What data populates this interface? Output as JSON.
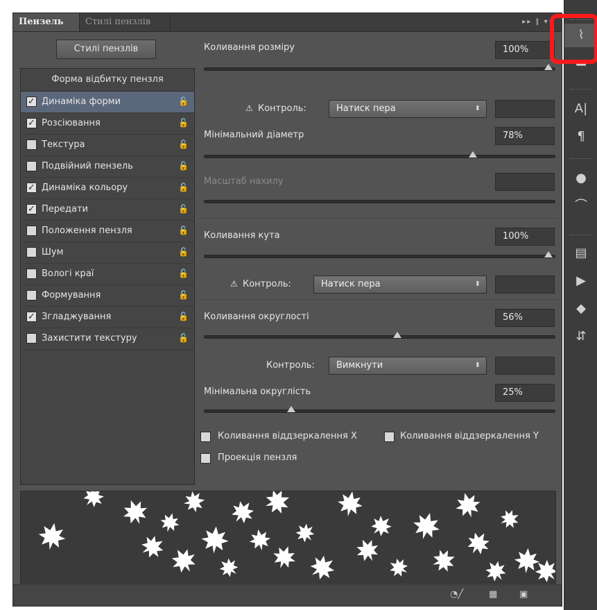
{
  "tabs": {
    "active": "Пензель",
    "inactive": "Стилі пензлів",
    "controls": "▸▸ ‖ ▾≡"
  },
  "presets_button": "Стилі пензлів",
  "list": {
    "header": "Форма відбитку пензля",
    "items": [
      {
        "label": "Динаміка форми",
        "checked": true,
        "selected": true
      },
      {
        "label": "Розсіювання",
        "checked": true,
        "selected": false
      },
      {
        "label": "Текстура",
        "checked": false,
        "selected": false
      },
      {
        "label": "Подвійний пензель",
        "checked": false,
        "selected": false
      },
      {
        "label": "Динаміка кольору",
        "checked": true,
        "selected": false
      },
      {
        "label": "Передати",
        "checked": true,
        "selected": false
      },
      {
        "label": "Положення пензля",
        "checked": false,
        "selected": false
      },
      {
        "label": "Шум",
        "checked": false,
        "selected": false
      },
      {
        "label": "Вологі краї",
        "checked": false,
        "selected": false
      },
      {
        "label": "Формування",
        "checked": false,
        "selected": false
      },
      {
        "label": "Згладжування",
        "checked": true,
        "selected": false
      },
      {
        "label": "Захистити текстуру",
        "checked": false,
        "selected": false
      }
    ]
  },
  "size_jitter": {
    "label": "Коливання розміру",
    "value": "100%",
    "slider": 1.0,
    "control_label": "Контроль:",
    "control_value": "Натиск пера"
  },
  "min_diameter": {
    "label": "Мінімальний діаметр",
    "value": "78%",
    "slider": 0.78
  },
  "tilt_scale": {
    "label": "Масштаб нахилу",
    "value": ""
  },
  "angle_jitter": {
    "label": "Коливання кута",
    "value": "100%",
    "slider": 1.0,
    "control_label": "Контроль:",
    "control_value": "Натиск пера"
  },
  "roundness_jitter": {
    "label": "Коливання округлості",
    "value": "56%",
    "slider": 0.56,
    "control_label": "Контроль:",
    "control_value": "Вимкнути"
  },
  "min_roundness": {
    "label": "Мінімальна округлість",
    "value": "25%",
    "slider": 0.25
  },
  "flip_x": "Коливання віддзеркалення X",
  "flip_y": "Коливання віддзеркалення Y",
  "projection": "Проекція пензля",
  "icons": {
    "warning": "⚠",
    "lock": "🔓",
    "checkmark": "✓",
    "dropdown_arrow": "⬍",
    "status": [
      "eye-brush-icon",
      "grid-icon",
      "new-preset-icon"
    ],
    "sidebar": [
      "brush-panel-icon",
      "clone-source-icon",
      "character-icon",
      "paragraph-icon",
      "color-icon",
      "paths-icon",
      "3d-icon",
      "actions-icon",
      "layers-icon",
      "history-icon"
    ]
  },
  "colors": {
    "highlight": "#ff1a1a",
    "selected_row": "#5b677a",
    "panel_bg": "#535353"
  }
}
